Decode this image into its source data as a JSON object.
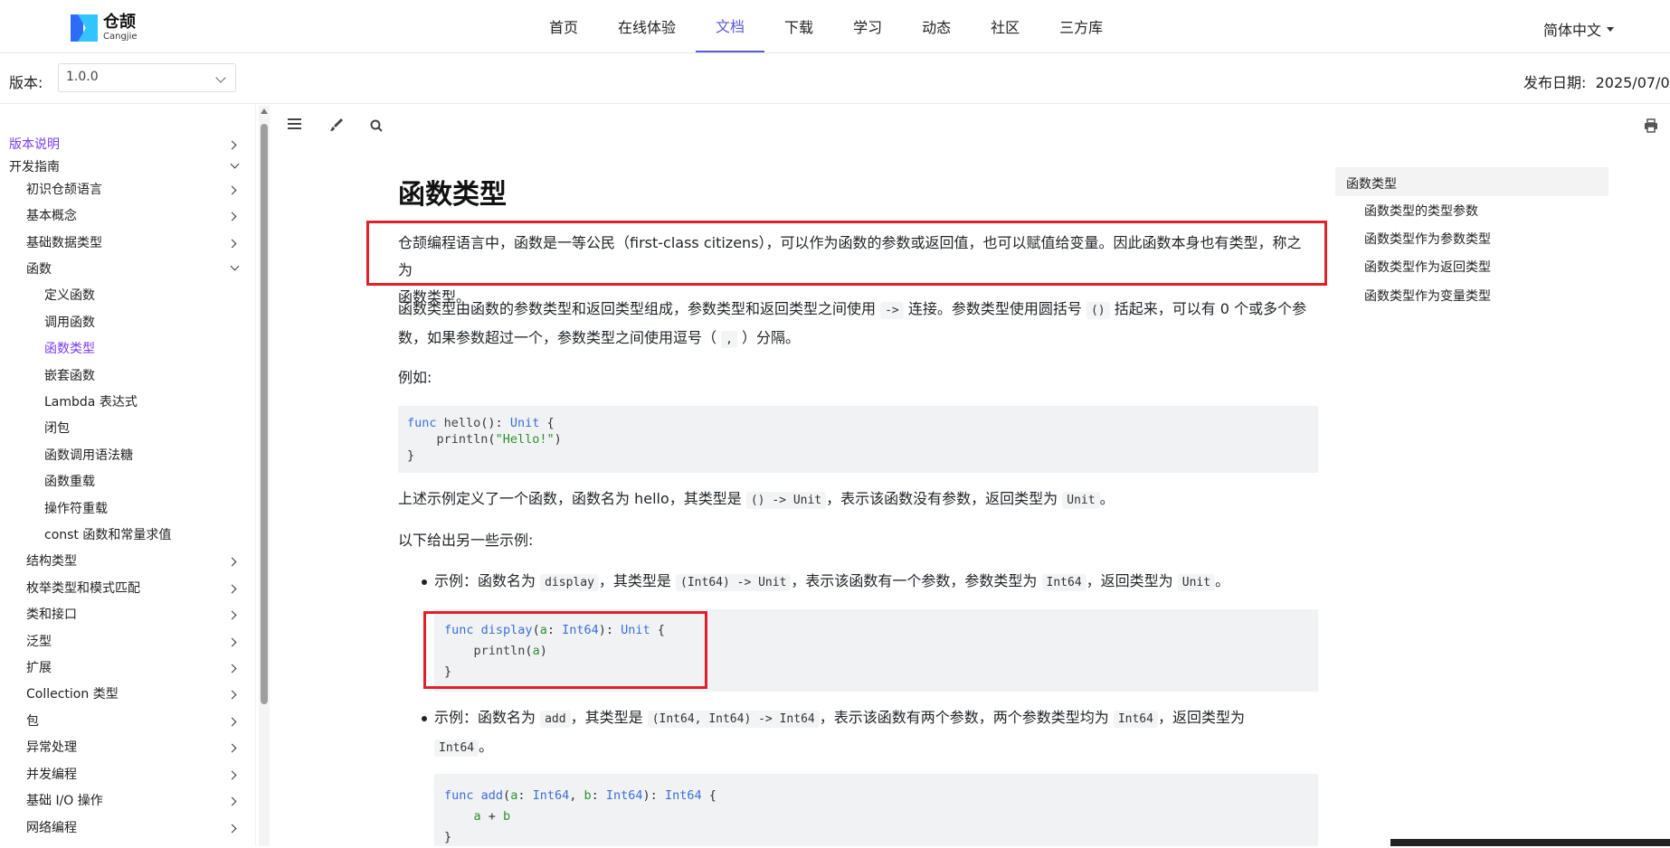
{
  "brand": {
    "name_cn": "仓颉",
    "name_en": "Cangjie"
  },
  "nav": {
    "items": [
      {
        "label": "首页",
        "active": false
      },
      {
        "label": "在线体验",
        "active": false
      },
      {
        "label": "文档",
        "active": true
      },
      {
        "label": "下载",
        "active": false
      },
      {
        "label": "学习",
        "active": false
      },
      {
        "label": "动态",
        "active": false
      },
      {
        "label": "社区",
        "active": false
      },
      {
        "label": "三方库",
        "active": false
      }
    ],
    "language": "简体中文"
  },
  "version_bar": {
    "label": "版本:",
    "selected_version": "1.0.0",
    "publish_date_label": "发布日期:",
    "publish_date": "2025/07/0"
  },
  "sidebar": {
    "items": [
      {
        "label": "版本说明",
        "level": 0,
        "active": true,
        "arrow": "right"
      },
      {
        "label": "开发指南",
        "level": 0,
        "active": false,
        "arrow": "down"
      },
      {
        "label": "初识仓颉语言",
        "level": 1,
        "active": false,
        "arrow": "right"
      },
      {
        "label": "基本概念",
        "level": 1,
        "active": false,
        "arrow": "right"
      },
      {
        "label": "基础数据类型",
        "level": 1,
        "active": false,
        "arrow": "right"
      },
      {
        "label": "函数",
        "level": 1,
        "active": false,
        "arrow": "down"
      },
      {
        "label": "定义函数",
        "level": 2,
        "active": false,
        "arrow": ""
      },
      {
        "label": "调用函数",
        "level": 2,
        "active": false,
        "arrow": ""
      },
      {
        "label": "函数类型",
        "level": 2,
        "active": true,
        "arrow": ""
      },
      {
        "label": "嵌套函数",
        "level": 2,
        "active": false,
        "arrow": ""
      },
      {
        "label": "Lambda 表达式",
        "level": 2,
        "active": false,
        "arrow": ""
      },
      {
        "label": "闭包",
        "level": 2,
        "active": false,
        "arrow": ""
      },
      {
        "label": "函数调用语法糖",
        "level": 2,
        "active": false,
        "arrow": ""
      },
      {
        "label": "函数重载",
        "level": 2,
        "active": false,
        "arrow": ""
      },
      {
        "label": "操作符重载",
        "level": 2,
        "active": false,
        "arrow": ""
      },
      {
        "label": "const 函数和常量求值",
        "level": 2,
        "active": false,
        "arrow": ""
      },
      {
        "label": "结构类型",
        "level": 1,
        "active": false,
        "arrow": "right"
      },
      {
        "label": "枚举类型和模式匹配",
        "level": 1,
        "active": false,
        "arrow": "right"
      },
      {
        "label": "类和接口",
        "level": 1,
        "active": false,
        "arrow": "right"
      },
      {
        "label": "泛型",
        "level": 1,
        "active": false,
        "arrow": "right"
      },
      {
        "label": "扩展",
        "level": 1,
        "active": false,
        "arrow": "right"
      },
      {
        "label": "Collection 类型",
        "level": 1,
        "active": false,
        "arrow": "right"
      },
      {
        "label": "包",
        "level": 1,
        "active": false,
        "arrow": "right"
      },
      {
        "label": "异常处理",
        "level": 1,
        "active": false,
        "arrow": "right"
      },
      {
        "label": "并发编程",
        "level": 1,
        "active": false,
        "arrow": "right"
      },
      {
        "label": "基础 I/O 操作",
        "level": 1,
        "active": false,
        "arrow": "right"
      },
      {
        "label": "网络编程",
        "level": 1,
        "active": false,
        "arrow": "right"
      }
    ]
  },
  "toolbar": {
    "menu_icon": "hamburger-icon",
    "brush_icon": "brush-icon",
    "search_icon": "search-icon",
    "print_icon": "printer-icon"
  },
  "article": {
    "title": "函数类型",
    "intro_1": "仓颉编程语言中，函数是一等公民（first-class citizens），可以作为函数的参数或返回值，也可以赋值给变量。因此函数本身也有类型，称之为",
    "intro_2": "函数类型。",
    "p2_a": "函数类型由函数的参数类型和返回类型组成，参数类型和返回类型之间使用",
    "p2_code_arrow": "->",
    "p2_b": "连接。参数类型使用圆括号",
    "p2_code_paren": "()",
    "p2_c": "括起来，可以有 0 个或多个参",
    "p2_d": "数，如果参数超过一个，参数类型之间使用逗号（",
    "p2_code_comma": ",",
    "p2_e": "）分隔。",
    "example_label": "例如:",
    "code1": {
      "l1_kw": "func",
      "l1_name": "hello",
      "l1_rest": "(): ",
      "l1_type": "Unit",
      "l1_brace": " {",
      "l2_fn": "println",
      "l2_str": "\"Hello!\"",
      "l3": "}"
    },
    "p3_a": "上述示例定义了一个函数，函数名为 hello，其类型是",
    "p3_code1": "() -> Unit",
    "p3_b": "，表示该函数没有参数，返回类型为",
    "p3_code2": "Unit",
    "p3_c": "。",
    "p4": "以下给出另一些示例:",
    "ex1": {
      "a": "示例：函数名为",
      "c1": "display",
      "b": "，其类型是",
      "c2": "(Int64) -> Unit",
      "c": "，表示该函数有一个参数，参数类型为",
      "c3": "Int64",
      "d": "，返回类型为",
      "c4": "Unit",
      "e": "。"
    },
    "code2": {
      "kw": "func",
      "name": "display",
      "param": "a",
      "ptype": "Int64",
      "rtype": "Unit",
      "fn": "println",
      "arg": "a",
      "close": "}"
    },
    "ex2": {
      "a": "示例：函数名为",
      "c1": "add",
      "b": "，其类型是",
      "c2": "(Int64, Int64) -> Int64",
      "c": "，表示该函数有两个参数，两个参数类型均为",
      "c3": "Int64",
      "d": "，返回类型为",
      "c4": "Int64",
      "e": "。"
    },
    "code3": {
      "kw": "func",
      "name": "add",
      "p1": "a",
      "t1": "Int64",
      "p2": "b",
      "t2": "Int64",
      "rtype": "Int64",
      "expr_a": "a",
      "expr_op": " + ",
      "expr_b": "b",
      "close": "}"
    }
  },
  "toc": {
    "header": "函数类型",
    "items": [
      "函数类型的类型参数",
      "函数类型作为参数类型",
      "函数类型作为返回类型",
      "函数类型作为变量类型"
    ]
  },
  "colors": {
    "accent": "#5b5bd6",
    "active_sidebar": "#7a3cf0",
    "highlight_border": "#e2202a"
  }
}
